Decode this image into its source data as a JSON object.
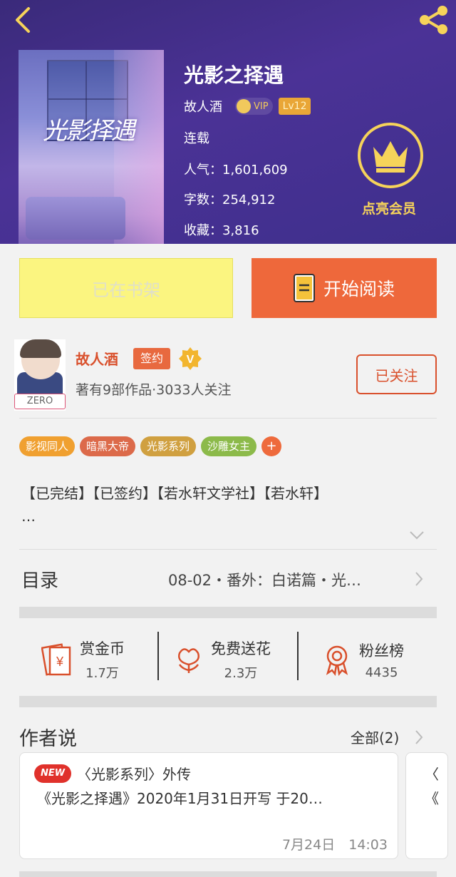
{
  "header": {
    "title": "光影之择遇",
    "author": "故人酒",
    "vip_label": "VIP",
    "level": "Lv12",
    "status": "连载",
    "popularity": "人气：1,601,609",
    "word_count": "字数：254,912",
    "favorites": "收藏：3,816",
    "cover_title": "光影择遇",
    "member_label": "点亮会员"
  },
  "actions": {
    "shelf_label": "已在书架",
    "read_label": "开始阅读"
  },
  "author_card": {
    "name": "故人酒",
    "sign_label": "签约",
    "v_label": "V",
    "works": "著有9部作品·3033人关注",
    "follow_label": "已关注",
    "avatar_tag": "ZERO"
  },
  "tags": [
    {
      "label": "影视同人",
      "color": "#f0a030"
    },
    {
      "label": "暗黑大帝",
      "color": "#dc6a4a"
    },
    {
      "label": "光影系列",
      "color": "#d0a040"
    },
    {
      "label": "沙雕女主",
      "color": "#8cba4a"
    }
  ],
  "tag_more": "+",
  "intro": {
    "line1": "【已完结】【已签约】【若水轩文学社】【若水轩】",
    "line2": "…"
  },
  "catalog": {
    "label": "目录",
    "latest": "08-02・番外：白诺篇・光…"
  },
  "stats": [
    {
      "name": "赏金币",
      "value": "1.7万",
      "icon": "red-envelope-icon"
    },
    {
      "name": "免费送花",
      "value": "2.3万",
      "icon": "flower-icon"
    },
    {
      "name": "粉丝榜",
      "value": "4435",
      "icon": "medal-icon"
    }
  ],
  "author_says": {
    "title": "作者说",
    "all_label": "全部(2)",
    "new_badge": "NEW",
    "line1": "〈光影系列〉外传",
    "line2": "《光影之择遇》2020年1月31日开写 于20…",
    "date": "7月24日　14:03",
    "peek_line1": "〈",
    "peek_line2": "《"
  },
  "colors": {
    "header_bg": "#4b3296",
    "accent_orange": "#ee683b",
    "shelf_yellow": "#fbf580",
    "gold": "#f6d35a",
    "red_text": "#d9502c"
  }
}
